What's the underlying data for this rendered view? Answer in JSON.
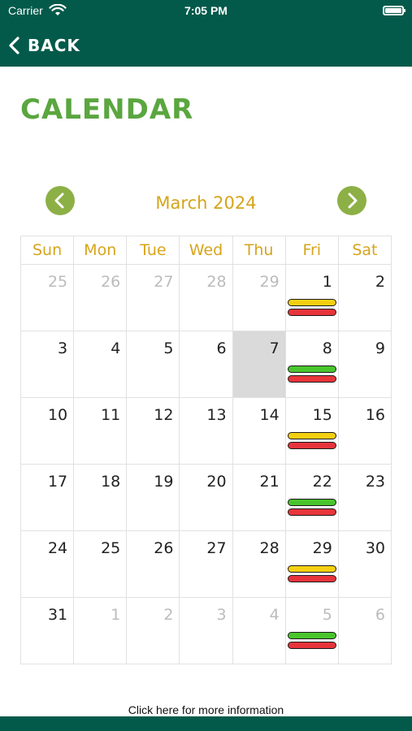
{
  "status_bar": {
    "carrier": "Carrier",
    "time": "7:05 PM"
  },
  "header": {
    "back_label": "BACK"
  },
  "title": "CALENDAR",
  "calendar": {
    "month_label": "March 2024",
    "weekdays": [
      "Sun",
      "Mon",
      "Tue",
      "Wed",
      "Thu",
      "Fri",
      "Sat"
    ],
    "weeks": [
      [
        {
          "day": "25",
          "muted": true
        },
        {
          "day": "26",
          "muted": true
        },
        {
          "day": "27",
          "muted": true
        },
        {
          "day": "28",
          "muted": true
        },
        {
          "day": "29",
          "muted": true
        },
        {
          "day": "1",
          "bars": [
            "yellow",
            "red"
          ]
        },
        {
          "day": "2"
        }
      ],
      [
        {
          "day": "3"
        },
        {
          "day": "4"
        },
        {
          "day": "5"
        },
        {
          "day": "6"
        },
        {
          "day": "7",
          "selected": true
        },
        {
          "day": "8",
          "bars": [
            "green",
            "red"
          ]
        },
        {
          "day": "9"
        }
      ],
      [
        {
          "day": "10"
        },
        {
          "day": "11"
        },
        {
          "day": "12"
        },
        {
          "day": "13"
        },
        {
          "day": "14"
        },
        {
          "day": "15",
          "bars": [
            "yellow",
            "red"
          ]
        },
        {
          "day": "16"
        }
      ],
      [
        {
          "day": "17"
        },
        {
          "day": "18"
        },
        {
          "day": "19"
        },
        {
          "day": "20"
        },
        {
          "day": "21"
        },
        {
          "day": "22",
          "bars": [
            "green",
            "red"
          ]
        },
        {
          "day": "23"
        }
      ],
      [
        {
          "day": "24"
        },
        {
          "day": "25"
        },
        {
          "day": "26"
        },
        {
          "day": "27"
        },
        {
          "day": "28"
        },
        {
          "day": "29",
          "bars": [
            "yellow",
            "red"
          ]
        },
        {
          "day": "30"
        }
      ],
      [
        {
          "day": "31"
        },
        {
          "day": "1",
          "muted": true
        },
        {
          "day": "2",
          "muted": true
        },
        {
          "day": "3",
          "muted": true
        },
        {
          "day": "4",
          "muted": true
        },
        {
          "day": "5",
          "muted": true,
          "bars": [
            "green",
            "red"
          ]
        },
        {
          "day": "6",
          "muted": true
        }
      ]
    ]
  },
  "footer": {
    "info_link": "Click here for more information"
  },
  "colors": {
    "header_bg": "#035a4a",
    "title_green": "#5aa63f",
    "month_gold": "#d6a41b",
    "nav_green": "#8cb046",
    "selected_gray": "#dadada",
    "bar_yellow": "#f4d011",
    "bar_red": "#e8343b",
    "bar_green": "#49c52d"
  },
  "icons": [
    "wifi-icon",
    "battery-icon",
    "back-chevron-icon",
    "chevron-left-icon",
    "chevron-right-icon"
  ]
}
